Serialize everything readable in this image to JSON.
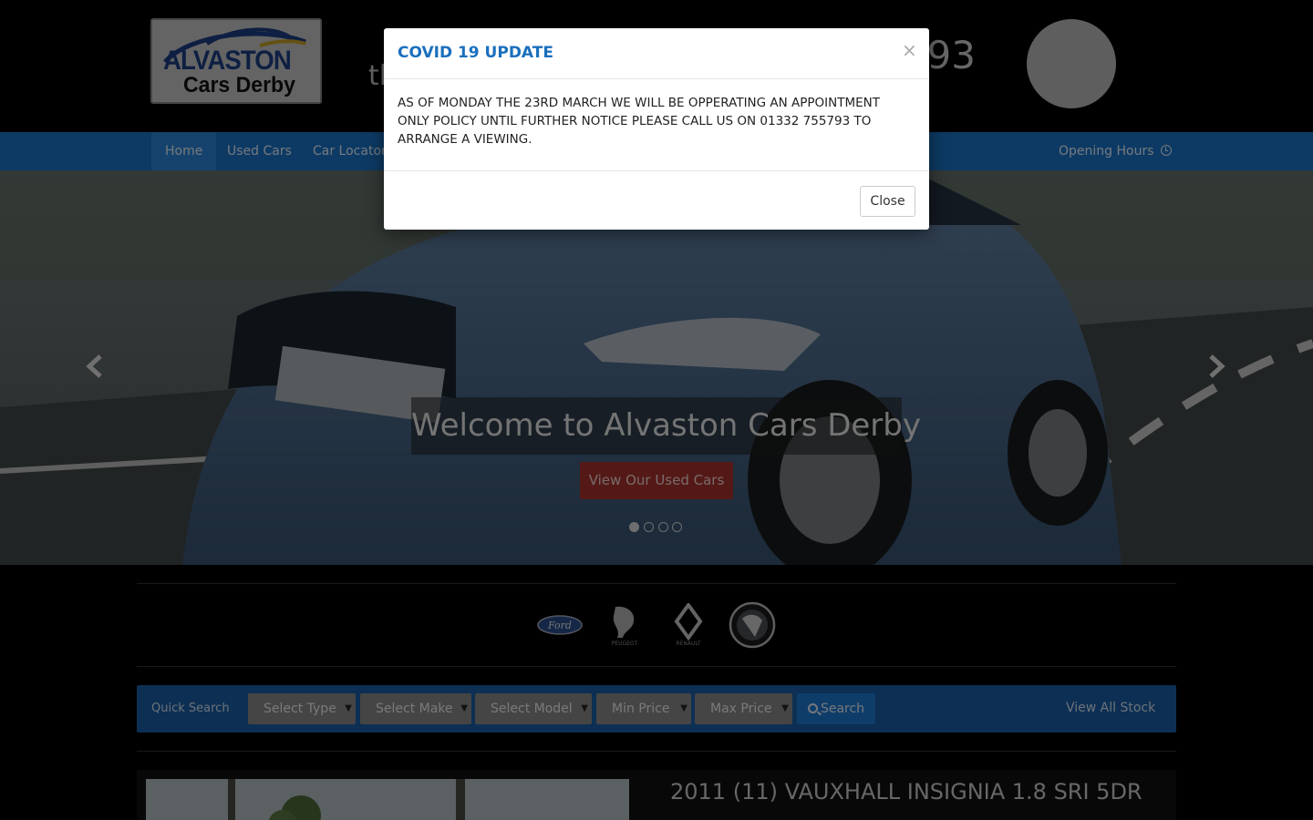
{
  "header": {
    "logo": {
      "line1": "ALVASTON",
      "line2": "Cars Derby"
    },
    "tagline_partial": "tl",
    "phone_partial": "793"
  },
  "nav": {
    "items": [
      {
        "label": "Home",
        "active": true
      },
      {
        "label": "Used Cars",
        "active": false
      },
      {
        "label": "Car Locator",
        "active": false
      }
    ],
    "opening_hours": "Opening Hours",
    "opening_hours_icon": "clock-icon"
  },
  "hero": {
    "headline": "Welcome to Alvaston Cars Derby",
    "cta": "View Our Used Cars",
    "slide_count": 4,
    "active_slide": 1
  },
  "brands": [
    "Ford",
    "Peugeot",
    "Renault",
    "Vauxhall"
  ],
  "quick_search": {
    "label": "Quick Search",
    "selects": [
      "Select Type",
      "Select Make",
      "Select Model",
      "Min Price",
      "Max Price"
    ],
    "search": "Search",
    "view_all": "View All Stock"
  },
  "listing": {
    "title": "2011 (11) VAUXHALL INSIGNIA 1.8 SRI 5DR"
  },
  "modal": {
    "title": "COVID 19 UPDATE",
    "body": "AS OF MONDAY THE 23RD MARCH WE WILL BE OPPERATING AN APPOINTMENT ONLY POLICY UNTIL FURTHER NOTICE PLEASE CALL US ON 01332 755793 TO ARRANGE A VIEWING.",
    "close_x": "×",
    "close_button": "Close"
  },
  "colors": {
    "nav_blue": "#1b74c9",
    "search_bar": "#1b5fa6",
    "cta_red": "#a9322c",
    "modal_title": "#1b6fbd"
  }
}
